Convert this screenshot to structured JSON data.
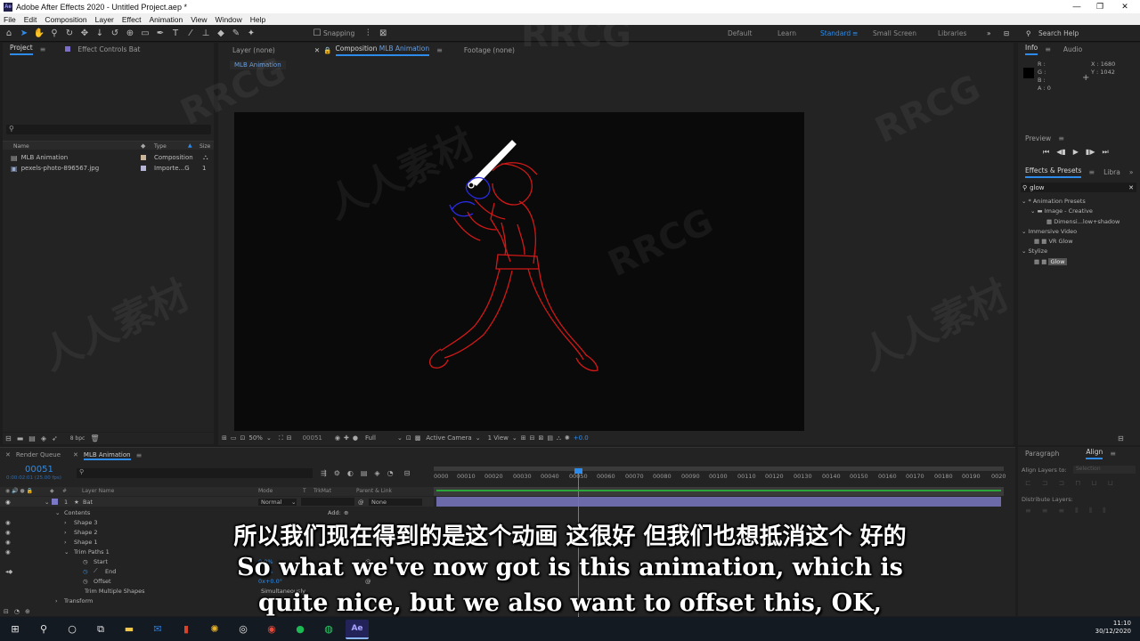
{
  "titlebar": {
    "title": "Adobe After Effects 2020 - Untitled Project.aep *",
    "minimize": "—",
    "maximize": "❐",
    "close": "✕"
  },
  "menu": [
    "File",
    "Edit",
    "Composition",
    "Layer",
    "Effect",
    "Animation",
    "View",
    "Window",
    "Help"
  ],
  "toolbar": {
    "snapping": "Snapping",
    "workspaces": [
      "Default",
      "Learn",
      "Standard",
      "Small Screen",
      "Libraries"
    ],
    "active_workspace": "Standard",
    "search_help": "Search Help"
  },
  "project": {
    "tab": "Project",
    "tab2": "Effect Controls Bat",
    "columns": {
      "name": "Name",
      "type": "Type",
      "size": "Size"
    },
    "items": [
      {
        "name": "MLB Animation",
        "type": "Composition",
        "size": ""
      },
      {
        "name": "pexels-photo-896567.jpg",
        "type": "Importe...G",
        "size": "1"
      }
    ],
    "bpc": "8 bpc"
  },
  "composition": {
    "tab_layer": "Layer (none)",
    "tab_comp_prefix": "Composition",
    "tab_comp_name": "MLB Animation",
    "tab_footage": "Footage (none)",
    "breadcrumb": "MLB Animation",
    "zoom": "50%",
    "timecode": "00051",
    "resolution": "Full",
    "camera": "Active Camera",
    "views": "1 View",
    "exposure": "+0.0"
  },
  "info": {
    "tab": "Info",
    "tab2": "Audio",
    "r": "R :",
    "g": "G :",
    "b": "B :",
    "a": "A : 0",
    "x": "X : 1680",
    "y": "Y : 1042"
  },
  "preview": {
    "tab": "Preview"
  },
  "effects": {
    "tab": "Effects & Presets",
    "tab2": "Libra",
    "search": "glow",
    "tree": [
      {
        "label": "* Animation Presets",
        "indent": 0
      },
      {
        "label": "Image - Creative",
        "indent": 1
      },
      {
        "label": "Dimensi...low+shadow",
        "indent": 2
      },
      {
        "label": "Immersive Video",
        "indent": 0
      },
      {
        "label": "VR Glow",
        "indent": 2
      },
      {
        "label": "Stylize",
        "indent": 0
      },
      {
        "label": "Glow",
        "indent": 2
      }
    ]
  },
  "timeline": {
    "tab_render": "Render Queue",
    "tab_comp": "MLB Animation",
    "timecode": "00051",
    "timecode_sub": "0:00:02:01 (25.00 fps)",
    "columns": {
      "layer_name": "Layer Name",
      "mode": "Mode",
      "t": "T",
      "trkmat": "TrkMat",
      "parent": "Parent & Link"
    },
    "ruler": [
      "0000",
      "00010",
      "00020",
      "00030",
      "00040",
      "00050",
      "00060",
      "00070",
      "00080",
      "00090",
      "00100",
      "00110",
      "00120",
      "00130",
      "00140",
      "00150",
      "00160",
      "00170",
      "00180",
      "00190",
      "0020"
    ],
    "layer": {
      "index": "1",
      "name": "Bat",
      "mode": "Normal",
      "parent": "None"
    },
    "rows": [
      "Contents",
      "Shape 3",
      "Shape 2",
      "Shape 1",
      "Trim Paths 1",
      "Start",
      "End",
      "Offset",
      "Trim Multiple Shapes",
      "Transform"
    ],
    "add": "Add:",
    "values": {
      "start": "0.0%",
      "end": "0.0%",
      "offset": "0x+0.0°",
      "trim": "Simultaneously"
    }
  },
  "align": {
    "tab": "Paragraph",
    "tab2": "Align",
    "align_to": "Align Layers to:",
    "selection": "Selection",
    "distribute": "Distribute Layers:"
  },
  "subtitles": {
    "cn": "所以我们现在得到的是这个动画 这很好 但我们也想抵消这个 好的",
    "en1": "So what we've now got is this animation, which is",
    "en2": "quite nice, but we also want to offset this, OK,"
  },
  "watermarks": {
    "rrcg": "RRCG",
    "cn": "人人素材"
  },
  "taskbar": {
    "time": "11:10",
    "date": "30/12/2020"
  }
}
